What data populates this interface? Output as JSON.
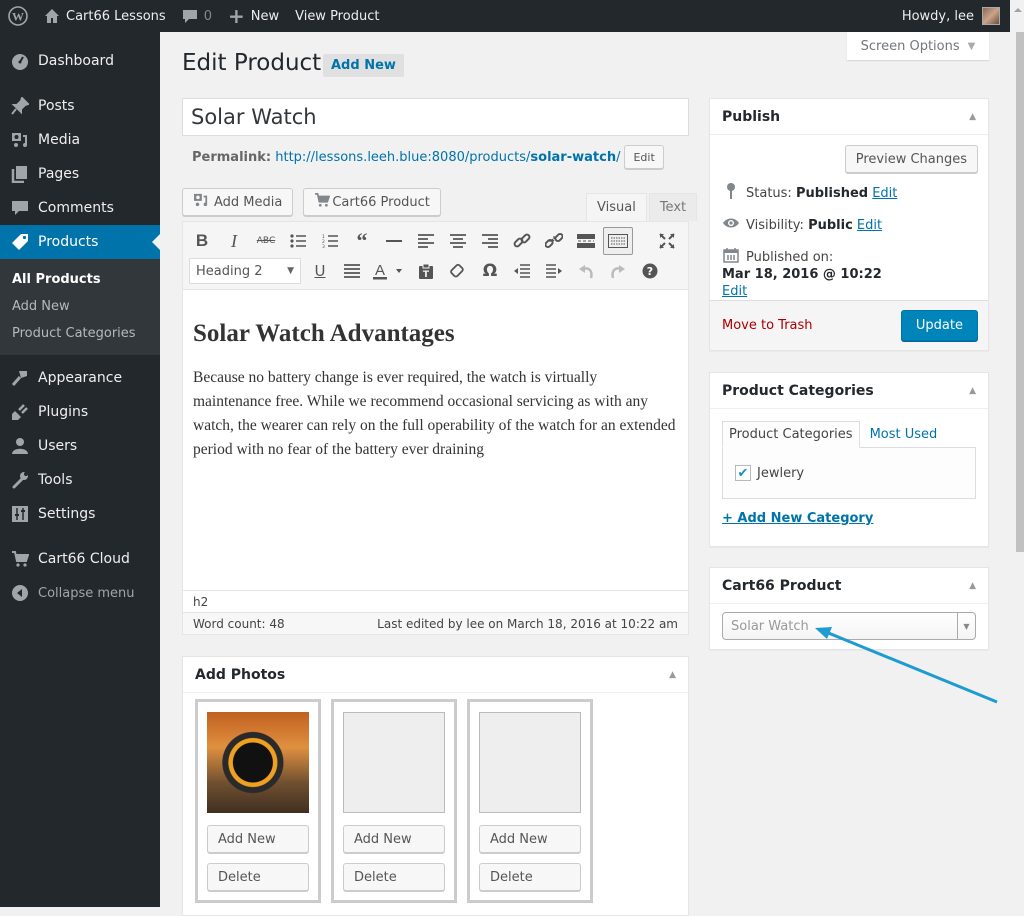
{
  "admin_bar": {
    "site_name": "Cart66 Lessons",
    "comments_count": "0",
    "new_label": "New",
    "view_label": "View Product",
    "greeting": "Howdy, lee"
  },
  "sidebar": {
    "items": [
      {
        "label": "Dashboard",
        "icon": "dashboard-icon"
      },
      {
        "label": "Posts",
        "icon": "pin-icon"
      },
      {
        "label": "Media",
        "icon": "media-icon"
      },
      {
        "label": "Pages",
        "icon": "pages-icon"
      },
      {
        "label": "Comments",
        "icon": "comment-icon"
      },
      {
        "label": "Products",
        "icon": "tag-icon",
        "active": true
      },
      {
        "label": "Appearance",
        "icon": "brush-icon"
      },
      {
        "label": "Plugins",
        "icon": "plug-icon"
      },
      {
        "label": "Users",
        "icon": "user-icon"
      },
      {
        "label": "Tools",
        "icon": "wrench-icon"
      },
      {
        "label": "Settings",
        "icon": "settings-icon"
      },
      {
        "label": "Cart66 Cloud",
        "icon": "cart-icon"
      }
    ],
    "submenu": [
      "All Products",
      "Add New",
      "Product Categories"
    ],
    "collapse_label": "Collapse menu"
  },
  "screen_options": "Screen Options",
  "page": {
    "title": "Edit Product",
    "add_new": "Add New"
  },
  "post": {
    "title": "Solar Watch",
    "permalink_label": "Permalink:",
    "permalink_base": "http://lessons.leeh.blue:8080/products/",
    "permalink_slug": "solar-watch",
    "permalink_trailing": "/",
    "permalink_edit": "Edit"
  },
  "editor": {
    "add_media": "Add Media",
    "cart66_product": "Cart66 Product",
    "tab_visual": "Visual",
    "tab_text": "Text",
    "format_select": "Heading 2",
    "heading": "Solar Watch Advantages",
    "paragraph": "Because no battery change is ever required, the watch is virtually maintenance free. While we recommend occasional servicing as with any watch, the wearer can rely on the full operability of the watch for an extended period with no fear of the battery ever draining",
    "path": "h2",
    "word_count": "Word count: 48",
    "last_edited": "Last edited by lee on March 18, 2016 at 10:22 am"
  },
  "photos": {
    "title": "Add Photos",
    "cards": [
      {
        "has_image": true,
        "add_label": "Add New",
        "delete_label": "Delete"
      },
      {
        "has_image": false,
        "add_label": "Add New",
        "delete_label": "Delete"
      },
      {
        "has_image": false,
        "add_label": "Add New",
        "delete_label": "Delete"
      }
    ]
  },
  "publish": {
    "title": "Publish",
    "preview": "Preview Changes",
    "status_label": "Status:",
    "status_value": "Published",
    "visibility_label": "Visibility:",
    "visibility_value": "Public",
    "published_label": "Published on:",
    "published_value": "Mar 18, 2016 @ 10:22",
    "edit": "Edit",
    "trash": "Move to Trash",
    "update": "Update"
  },
  "categories": {
    "title": "Product Categories",
    "tab_all": "Product Categories",
    "tab_most_used": "Most Used",
    "items": [
      {
        "label": "Jewlery",
        "checked": true
      }
    ],
    "add_new": "+ Add New Category"
  },
  "cart66_box": {
    "title": "Cart66 Product",
    "selected": "Solar Watch"
  },
  "colors": {
    "accent": "#0073aa",
    "update_button": "#0085ba",
    "trash": "#aa0000",
    "annotation_arrow": "#1e9bd0"
  }
}
